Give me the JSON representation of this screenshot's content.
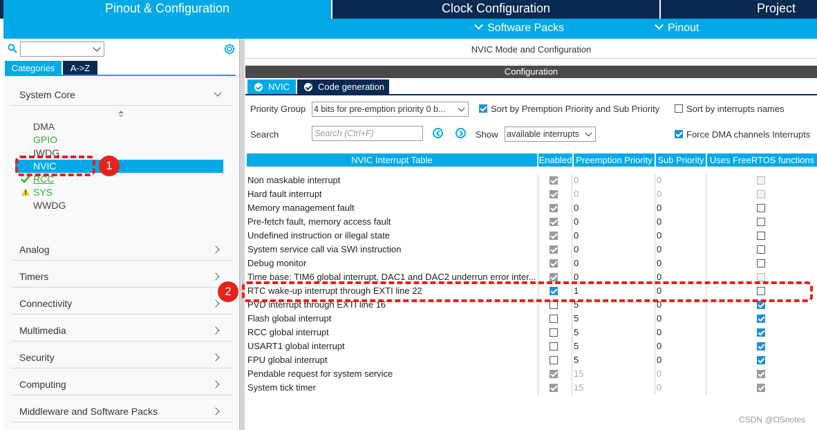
{
  "top_tabs": {
    "pinout": "Pinout & Configuration",
    "clock": "Clock Configuration",
    "project": "Project"
  },
  "sub_bar": {
    "software_packs": "Software Packs",
    "pinout": "Pinout"
  },
  "left": {
    "search_placeholder": "",
    "tabs": {
      "categories": "Categories",
      "az": "A->Z"
    },
    "groups": [
      {
        "label": "System Core",
        "expanded": true
      },
      {
        "label": "Analog"
      },
      {
        "label": "Timers"
      },
      {
        "label": "Connectivity"
      },
      {
        "label": "Multimedia"
      },
      {
        "label": "Security"
      },
      {
        "label": "Computing"
      },
      {
        "label": "Middleware and Software Packs"
      }
    ],
    "system_core_items": [
      {
        "label": "DMA",
        "state": "normal"
      },
      {
        "label": "GPIO",
        "state": "green"
      },
      {
        "label": "IWDG",
        "state": "normal"
      },
      {
        "label": "NVIC",
        "state": "selected"
      },
      {
        "label": "RCC",
        "state": "check-green"
      },
      {
        "label": "SYS",
        "state": "warning"
      },
      {
        "label": "WWDG",
        "state": "normal"
      }
    ]
  },
  "right": {
    "mode_title": "NVIC Mode and Configuration",
    "config_title": "Configuration",
    "tabs": {
      "nvic": "NVIC",
      "code_generation": "Code generation"
    },
    "priority_group_label": "Priority Group",
    "priority_group_value": "4 bits for pre-emption priority 0 b...",
    "sort_premption_label": "Sort by Premption Priority and Sub Priority",
    "sort_premption_checked": true,
    "sort_names_label": "Sort by interrupts names",
    "sort_names_checked": false,
    "search_label": "Search",
    "search_placeholder": "Search (Ctrl+F)",
    "show_label": "Show",
    "show_value": "available interrupts",
    "force_dma_label": "Force DMA channels Interrupts",
    "force_dma_checked": true
  },
  "table": {
    "headers": [
      "NVIC Interrupt Table",
      "Enabled",
      "Preemption Priority",
      "Sub Priority",
      "Uses FreeRTOS functions"
    ],
    "rows": [
      {
        "name": "Non maskable interrupt",
        "enabled": "dison",
        "pre": "0",
        "sub": "0",
        "rtos": "dis",
        "grey": true
      },
      {
        "name": "Hard fault interrupt",
        "enabled": "dison",
        "pre": "0",
        "sub": "0",
        "rtos": "dis",
        "grey": true
      },
      {
        "name": "Memory management fault",
        "enabled": "dison",
        "pre": "0",
        "sub": "0",
        "rtos": "off",
        "grey": false
      },
      {
        "name": "Pre-fetch fault, memory access fault",
        "enabled": "dison",
        "pre": "0",
        "sub": "0",
        "rtos": "off",
        "grey": false
      },
      {
        "name": "Undefined instruction or illegal state",
        "enabled": "dison",
        "pre": "0",
        "sub": "0",
        "rtos": "off",
        "grey": false
      },
      {
        "name": "System service call via SWI instruction",
        "enabled": "dison",
        "pre": "0",
        "sub": "0",
        "rtos": "off",
        "grey": false
      },
      {
        "name": "Debug monitor",
        "enabled": "dison",
        "pre": "0",
        "sub": "0",
        "rtos": "off",
        "grey": false
      },
      {
        "name": "Time base: TIM6 global interrupt, DAC1 and DAC2 underrun error inter...",
        "enabled": "dison",
        "pre": "0",
        "sub": "0",
        "rtos": "dis",
        "grey": false
      },
      {
        "name": "RTC wake-up interrupt through EXTI line 22",
        "enabled": "on",
        "pre": "1",
        "sub": "0",
        "rtos": "off",
        "grey": false
      },
      {
        "name": "PVD interrupt through EXTI line 16",
        "enabled": "off",
        "pre": "5",
        "sub": "0",
        "rtos": "on",
        "grey": false
      },
      {
        "name": "Flash global interrupt",
        "enabled": "off",
        "pre": "5",
        "sub": "0",
        "rtos": "on",
        "grey": false
      },
      {
        "name": "RCC global interrupt",
        "enabled": "off",
        "pre": "5",
        "sub": "0",
        "rtos": "on",
        "grey": false
      },
      {
        "name": "USART1 global interrupt",
        "enabled": "off",
        "pre": "5",
        "sub": "0",
        "rtos": "on",
        "grey": false
      },
      {
        "name": "FPU global interrupt",
        "enabled": "off",
        "pre": "5",
        "sub": "0",
        "rtos": "on",
        "grey": false
      },
      {
        "name": "Pendable request for system service",
        "enabled": "dison",
        "pre": "15",
        "sub": "0",
        "rtos": "dison",
        "grey": true
      },
      {
        "name": "System tick timer",
        "enabled": "dison",
        "pre": "15",
        "sub": "0",
        "rtos": "dison",
        "grey": true
      }
    ]
  },
  "annotations": {
    "marker1": "1",
    "marker2": "2"
  },
  "watermark": "CSDN @OSnotes",
  "colors": {
    "accent": "#03a9e7",
    "navy": "#0a2a52",
    "annotation": "#e5221c"
  }
}
